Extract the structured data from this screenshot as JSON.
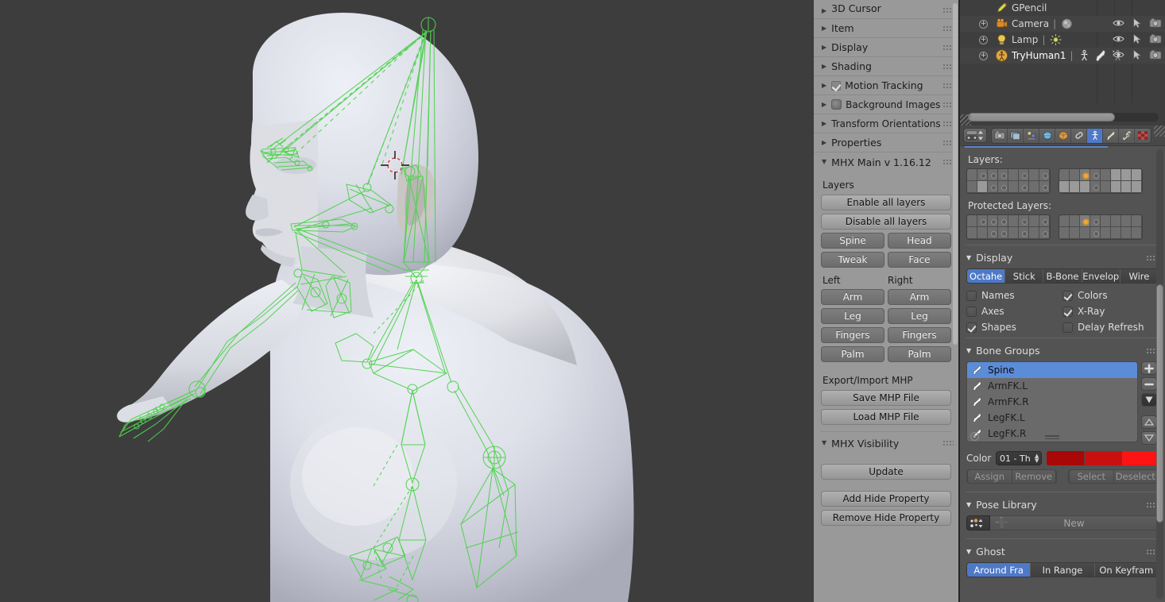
{
  "viewport": {
    "name": "3d-viewport",
    "background_color": "#3d3d3d",
    "mesh_color": "#cfcfdc",
    "armature_color": "#4fd24f",
    "cursor_label": "3d-cursor"
  },
  "toolpanel": {
    "rows": [
      {
        "label": "3D Cursor",
        "expanded": false,
        "icon": null
      },
      {
        "label": "Item",
        "expanded": false,
        "icon": null
      },
      {
        "label": "Display",
        "expanded": false,
        "icon": null
      },
      {
        "label": "Shading",
        "expanded": false,
        "icon": null
      },
      {
        "label": "Motion Tracking",
        "expanded": false,
        "icon": "checkbox-checked"
      },
      {
        "label": "Background Images",
        "expanded": false,
        "icon": "image-chip"
      },
      {
        "label": "Transform Orientations",
        "expanded": false,
        "icon": null
      },
      {
        "label": "Properties",
        "expanded": false,
        "icon": null
      }
    ],
    "mhx_main": {
      "title": "MHX Main v 1.16.12",
      "expanded": true,
      "layers_label": "Layers",
      "enable_all": "Enable all layers",
      "disable_all": "Disable all layers",
      "pairs": [
        [
          "Spine",
          "Head"
        ],
        [
          "Tweak",
          "Face"
        ]
      ],
      "left_label": "Left",
      "right_label": "Right",
      "lr_pairs": [
        [
          "Arm",
          "Arm"
        ],
        [
          "Leg",
          "Leg"
        ],
        [
          "Fingers",
          "Fingers"
        ],
        [
          "Palm",
          "Palm"
        ]
      ],
      "export_label": "Export/Import MHP",
      "save_mhp": "Save MHP File",
      "load_mhp": "Load MHP File"
    },
    "mhx_visibility": {
      "title": "MHX Visibility",
      "expanded": true,
      "update": "Update",
      "add_hide": "Add Hide Property",
      "remove_hide": "Remove Hide Property"
    }
  },
  "outliner": {
    "rows": [
      {
        "name": "GPencil",
        "icon": "pencil-icon",
        "expandable": false,
        "data_icon": null,
        "extra_icons": [],
        "show_toggles": false
      },
      {
        "name": "Camera",
        "icon": "camera-icon",
        "expandable": true,
        "data_icon": "camera-data-icon",
        "extra_icons": [],
        "show_toggles": true
      },
      {
        "name": "Lamp",
        "icon": "lamp-icon",
        "expandable": true,
        "data_icon": "lamp-data-icon",
        "extra_icons": [],
        "show_toggles": true
      },
      {
        "name": "TryHuman1",
        "icon": "armature-icon",
        "expandable": true,
        "data_icon": null,
        "extra_icons": [
          "armature-data-icon",
          "pose-icon",
          "armature-modifier-icon"
        ],
        "show_toggles": true
      }
    ],
    "toggle_icons": [
      "eye-icon",
      "cursor-arrow-icon",
      "camera-render-icon"
    ]
  },
  "properties": {
    "header": {
      "browse_icon": "browse-datablock-icon",
      "tabs": [
        {
          "name": "render-tab",
          "icon": "camera-back-icon",
          "active": false
        },
        {
          "name": "render-layers-tab",
          "icon": "images-icon",
          "active": false
        },
        {
          "name": "scene-tab",
          "icon": "scene-icon",
          "active": false
        },
        {
          "name": "world-tab",
          "icon": "world-icon",
          "active": false
        },
        {
          "name": "object-tab",
          "icon": "cube-icon",
          "active": false
        },
        {
          "name": "constraints-tab",
          "icon": "chain-icon",
          "active": false
        },
        {
          "name": "object-data-tab",
          "icon": "armature-data-icon",
          "active": true
        },
        {
          "name": "bone-tab",
          "icon": "bone-icon",
          "active": false
        },
        {
          "name": "bone-constraints-tab",
          "icon": "bone-chain-icon",
          "active": false
        },
        {
          "name": "texture-tab",
          "icon": "checker-icon",
          "active": false
        }
      ]
    },
    "layers": {
      "label": "Layers:",
      "protected_label": "Protected Layers:",
      "left_grid": {
        "row1": [
          "empty",
          "dot",
          "dot",
          "dot",
          "empty",
          "dot",
          "empty",
          "dot"
        ],
        "row2": [
          "empty",
          "pale",
          "dot",
          "dot",
          "empty",
          "dot",
          "empty",
          "dot"
        ]
      },
      "right_grid": {
        "row1": [
          "empty",
          "empty",
          "active",
          "dot",
          "empty",
          "pale",
          "pale",
          "pale"
        ],
        "row2": [
          "pale",
          "pale",
          "pale",
          "dot",
          "empty",
          "pale",
          "pale",
          "pale"
        ]
      },
      "protected_left_grid": {
        "row1": [
          "empty",
          "dot",
          "dot",
          "dot",
          "empty",
          "dot",
          "empty",
          "dot"
        ],
        "row2": [
          "empty",
          "empty",
          "dot",
          "dot",
          "empty",
          "dot",
          "empty",
          "dot"
        ]
      },
      "protected_right_grid": {
        "row1": [
          "empty",
          "empty",
          "active",
          "dot",
          "empty",
          "empty",
          "empty",
          "empty"
        ],
        "row2": [
          "empty",
          "empty",
          "empty",
          "dot",
          "empty",
          "empty",
          "empty",
          "empty"
        ]
      }
    },
    "display": {
      "title": "Display",
      "expanded": true,
      "modes": [
        {
          "label": "Octahe",
          "active": true
        },
        {
          "label": "Stick",
          "active": false
        },
        {
          "label": "B-Bone",
          "active": false
        },
        {
          "label": "Envelop",
          "active": false
        },
        {
          "label": "Wire",
          "active": false
        }
      ],
      "checks": [
        {
          "label": "Names",
          "checked": false
        },
        {
          "label": "Colors",
          "checked": true
        },
        {
          "label": "Axes",
          "checked": false
        },
        {
          "label": "X-Ray",
          "checked": true
        },
        {
          "label": "Shapes",
          "checked": true
        },
        {
          "label": "Delay Refresh",
          "checked": false
        }
      ]
    },
    "bone_groups": {
      "title": "Bone Groups",
      "expanded": true,
      "items": [
        {
          "label": "Spine",
          "selected": true
        },
        {
          "label": "ArmFK.L",
          "selected": false
        },
        {
          "label": "ArmFK.R",
          "selected": false
        },
        {
          "label": "LegFK.L",
          "selected": false
        },
        {
          "label": "LegFK.R",
          "selected": false
        }
      ],
      "side_buttons": [
        "add-icon",
        "remove-icon",
        "specials-icon",
        "move-up-icon",
        "move-down-icon"
      ],
      "color_label": "Color",
      "color_set": "01 - Th",
      "swatches": [
        "#a80808",
        "#c81010",
        "#ff1414"
      ],
      "assign_label": "Assign",
      "remove_label": "Remove",
      "select_label": "Select",
      "deselect_label": "Deselect"
    },
    "pose_library": {
      "title": "Pose Library",
      "expanded": true,
      "new_label": "New",
      "browse_icon": "browse-pose-icon",
      "add_icon": "plus-icon"
    },
    "ghost": {
      "title": "Ghost",
      "expanded": true,
      "modes": [
        {
          "label": "Around Fra",
          "active": true
        },
        {
          "label": "In Range",
          "active": false
        },
        {
          "label": "On Keyfram",
          "active": false
        }
      ]
    }
  }
}
